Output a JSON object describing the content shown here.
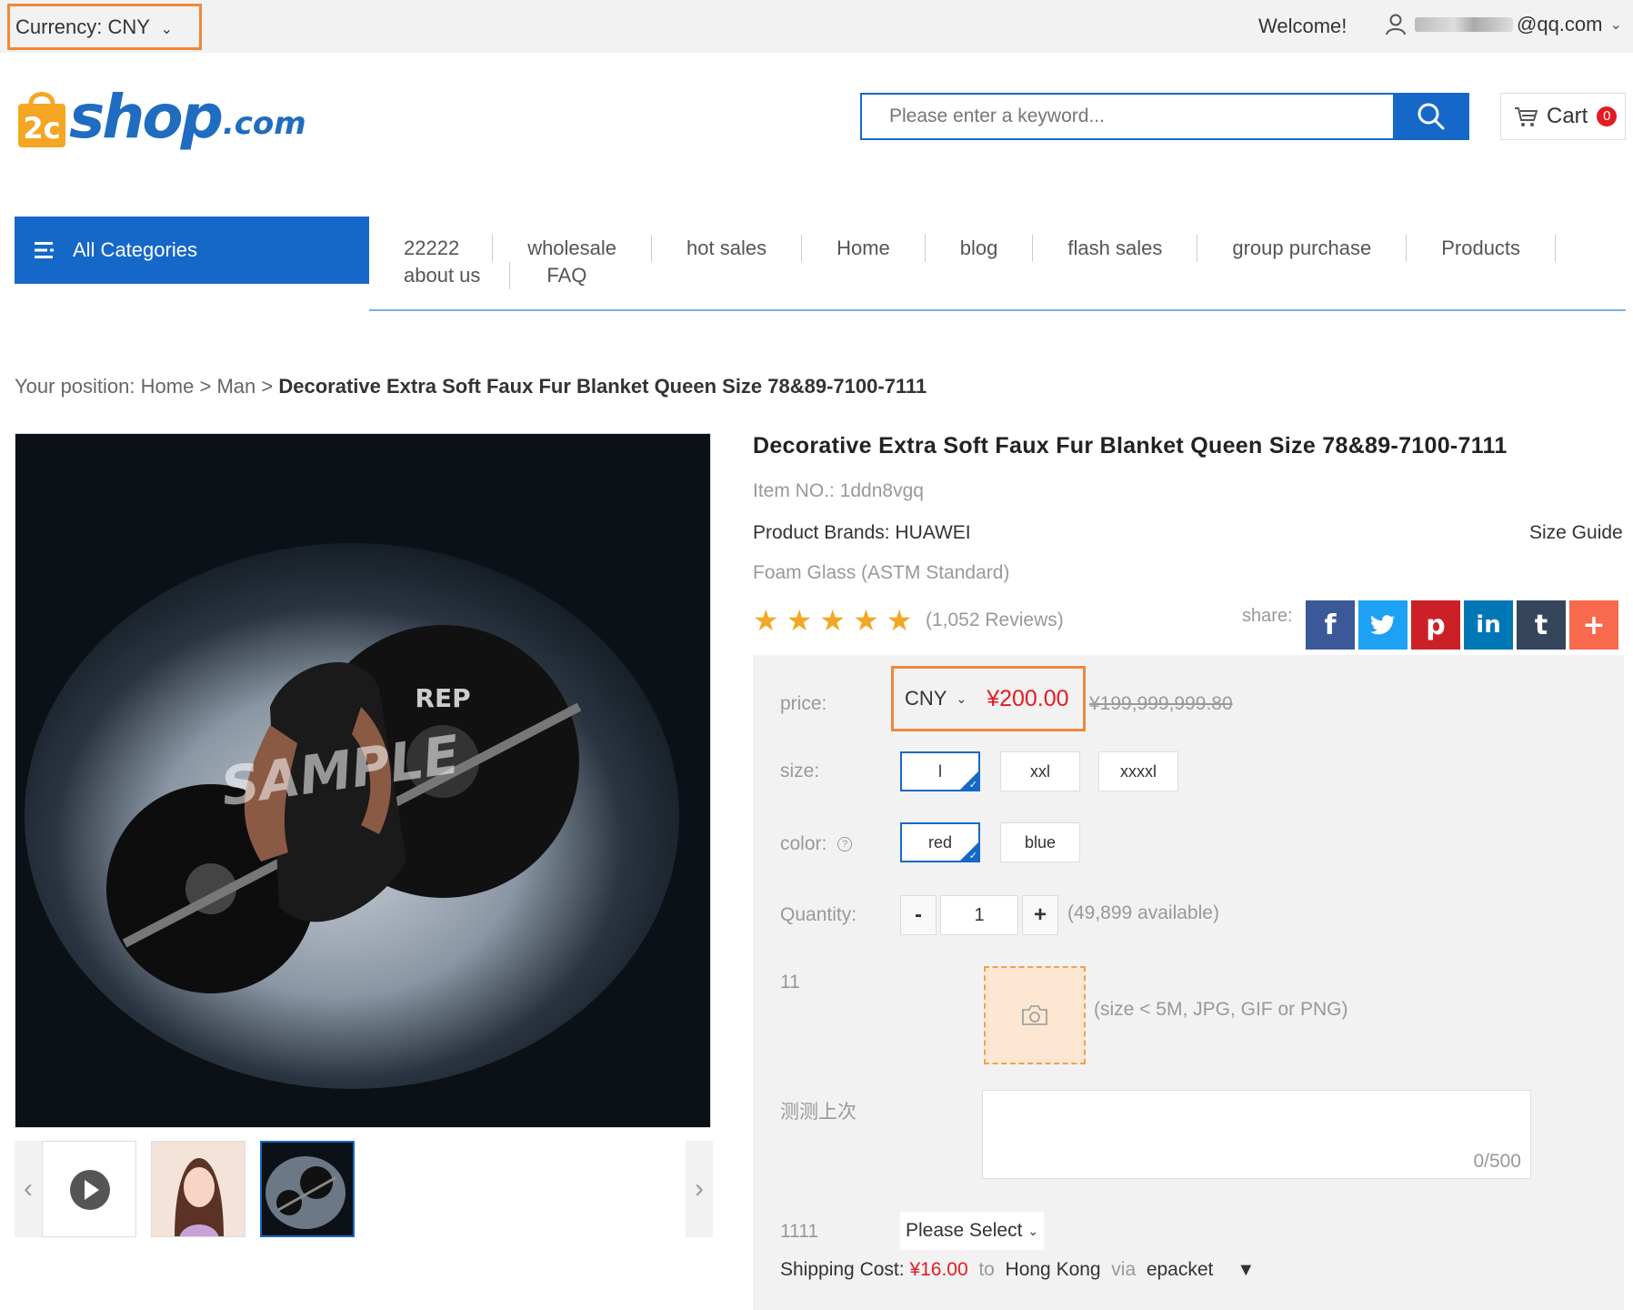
{
  "topbar": {
    "currency_label": "Currency:",
    "currency_value": "CNY",
    "welcome": "Welcome!",
    "user_email_suffix": "@qq.com"
  },
  "header": {
    "logo_text": "shop",
    "logo_tld": ".com",
    "search_placeholder": "Please enter a keyword...",
    "cart_label": "Cart",
    "cart_count": "0"
  },
  "nav": {
    "all_categories": "All Categories",
    "row1": [
      "22222",
      "wholesale",
      "hot sales",
      "Home",
      "blog",
      "flash sales",
      "group purchase",
      "Products"
    ],
    "row2": [
      "about us",
      "FAQ"
    ]
  },
  "breadcrumb": {
    "prefix": "Your position:",
    "home": "Home",
    "sep": ">",
    "category": "Man",
    "current": "Decorative Extra Soft Faux Fur Blanket Queen Size 78&89-7100-7111"
  },
  "gallery": {
    "watermark": "SAMPLE",
    "prev": "‹",
    "next": "›"
  },
  "product": {
    "title": "Decorative Extra Soft Faux Fur Blanket Queen Size 78&89-7100-7111",
    "item_no": "Item NO.: 1ddn8vgq",
    "brands": "Product Brands: HUAWEI",
    "size_guide": "Size Guide",
    "subtitle": "Foam Glass (ASTM Standard)",
    "rating": 5,
    "reviews": "(1,052 Reviews)",
    "share_label": "share:",
    "share_buttons": [
      {
        "name": "facebook",
        "glyph": "f",
        "color": "#3b5998"
      },
      {
        "name": "twitter",
        "glyph": "t",
        "color": "#1da1f2"
      },
      {
        "name": "pinterest",
        "glyph": "p",
        "color": "#cb2027"
      },
      {
        "name": "linkedin",
        "glyph": "in",
        "color": "#0077b5"
      },
      {
        "name": "tumblr",
        "glyph": "t",
        "color": "#35465c"
      },
      {
        "name": "more",
        "glyph": "+",
        "color": "#f8694d"
      }
    ]
  },
  "purchase": {
    "price_label": "price:",
    "price_currency": "CNY",
    "price": "¥200.00",
    "old_price": "¥199,999,999.80",
    "size_label": "size:",
    "sizes": [
      "l",
      "xxl",
      "xxxxl"
    ],
    "color_label": "color:",
    "colors": [
      "red",
      "blue"
    ],
    "quantity_label": "Quantity:",
    "qty_minus": "-",
    "qty_plus": "+",
    "quantity": "1",
    "available": "(49,899 available)",
    "upload_label": "11",
    "upload_hint": "(size < 5M, JPG, GIF or PNG)",
    "note_label": "测测上次",
    "note_count": "0/500",
    "select_label": "1111",
    "select_value": "Please Select",
    "shipping_label": "Shipping Cost:",
    "shipping_cost": "¥16.00",
    "to": "to",
    "destination": "Hong Kong",
    "via": "via",
    "carrier": "epacket"
  }
}
